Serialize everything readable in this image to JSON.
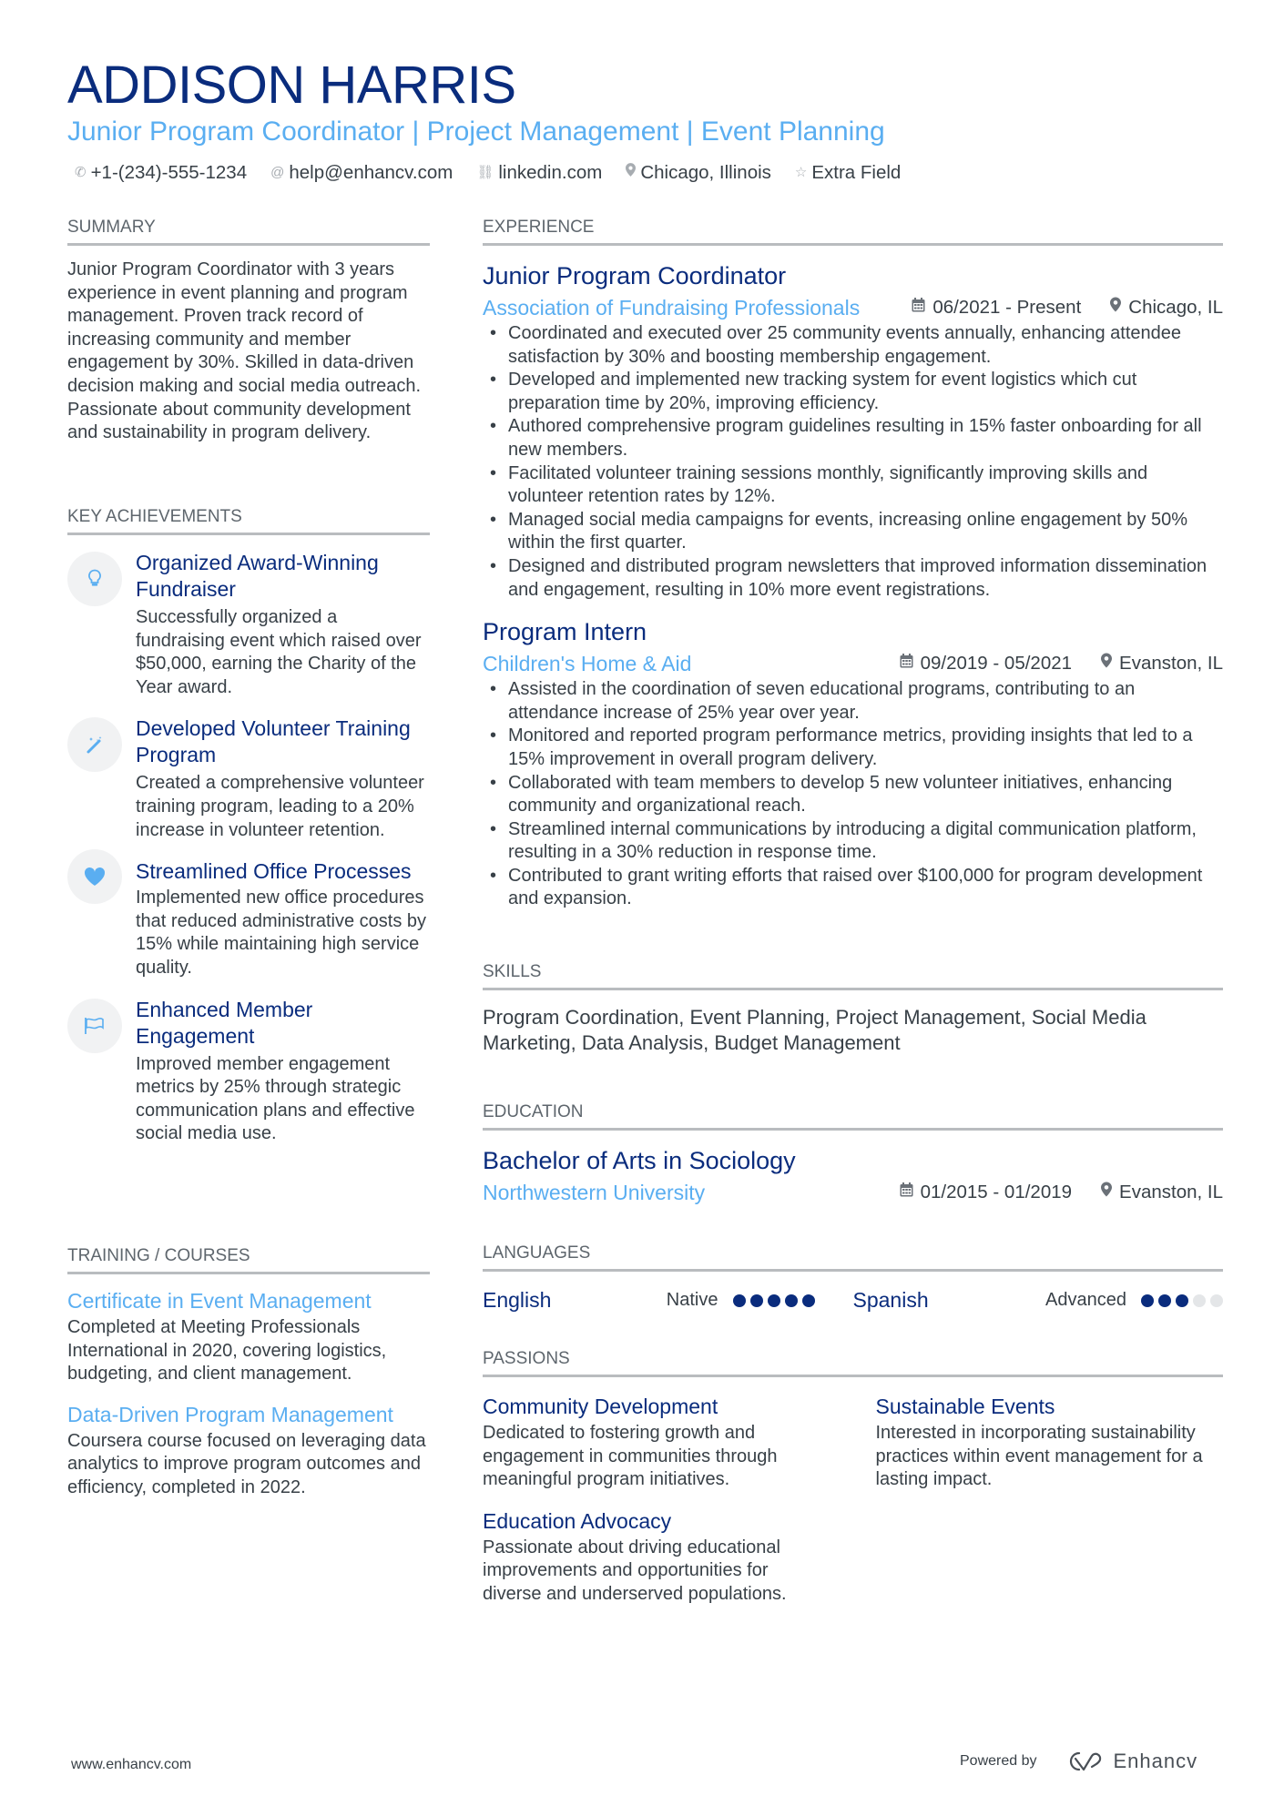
{
  "header": {
    "name": "ADDISON HARRIS",
    "subtitle": "Junior Program Coordinator | Project Management | Event Planning",
    "contacts": [
      {
        "icon": "phone-icon",
        "glyph": "✆",
        "text": "+1-(234)-555-1234"
      },
      {
        "icon": "at-icon",
        "glyph": "@",
        "text": "help@enhancv.com"
      },
      {
        "icon": "link-icon",
        "glyph": "🔗︎",
        "text": "linkedin.com"
      },
      {
        "icon": "location-icon",
        "glyph": "⚲",
        "text": "Chicago, Illinois"
      },
      {
        "icon": "star-icon",
        "glyph": "☆",
        "text": "Extra Field"
      }
    ]
  },
  "summary": {
    "title": "SUMMARY",
    "text": "Junior Program Coordinator with 3 years experience in event planning and program management. Proven track record of increasing community and member engagement by 30%. Skilled in data-driven decision making and social media outreach. Passionate about community development and sustainability in program delivery."
  },
  "achievements": {
    "title": "KEY ACHIEVEMENTS",
    "items": [
      {
        "icon": "lightbulb-icon",
        "glyph": "💡︎",
        "title": "Organized Award-Winning Fundraiser",
        "text": "Successfully organized a fundraising event which raised over $50,000, earning the Charity of the Year award."
      },
      {
        "icon": "magic-wand-icon",
        "glyph": "⁄",
        "title": "Developed Volunteer Training Program",
        "text": "Created a comprehensive volunteer training program, leading to a 20% increase in volunteer retention."
      },
      {
        "icon": "heart-icon",
        "glyph": "♥",
        "title": "Streamlined Office Processes",
        "text": "Implemented new office procedures that reduced administrative costs by 15% while maintaining high service quality."
      },
      {
        "icon": "flag-icon",
        "glyph": "⚐",
        "title": "Enhanced Member Engagement",
        "text": "Improved member engagement metrics by 25% through strategic communication plans and effective social media use."
      }
    ]
  },
  "training": {
    "title": "TRAINING / COURSES",
    "items": [
      {
        "title": "Certificate in Event Management",
        "text": "Completed at Meeting Professionals International in 2020, covering logistics, budgeting, and client management."
      },
      {
        "title": "Data-Driven Program Management",
        "text": "Coursera course focused on leveraging data analytics to improve program outcomes and efficiency, completed in 2022."
      }
    ]
  },
  "experience": {
    "title": "EXPERIENCE",
    "jobs": [
      {
        "title": "Junior Program Coordinator",
        "company": "Association of Fundraising Professionals",
        "dates": "06/2021 - Present",
        "location": "Chicago, IL",
        "bullets": [
          "Coordinated and executed over 25 community events annually, enhancing attendee satisfaction by 30% and boosting membership engagement.",
          "Developed and implemented new tracking system for event logistics which cut preparation time by 20%, improving efficiency.",
          "Authored comprehensive program guidelines resulting in 15% faster onboarding for all new members.",
          "Facilitated volunteer training sessions monthly, significantly improving skills and volunteer retention rates by 12%.",
          "Managed social media campaigns for events, increasing online engagement by 50% within the first quarter.",
          "Designed and distributed program newsletters that improved information dissemination and engagement, resulting in 10% more event registrations."
        ]
      },
      {
        "title": "Program Intern",
        "company": "Children's Home & Aid",
        "dates": "09/2019 - 05/2021",
        "location": "Evanston, IL",
        "bullets": [
          "Assisted in the coordination of seven educational programs, contributing to an attendance increase of 25% year over year.",
          "Monitored and reported program performance metrics, providing insights that led to a 15% improvement in overall program delivery.",
          "Collaborated with team members to develop 5 new volunteer initiatives, enhancing community and organizational reach.",
          "Streamlined internal communications by introducing a digital communication platform, resulting in a 30% reduction in response time.",
          "Contributed to grant writing efforts that raised over $100,000 for program development and expansion."
        ]
      }
    ]
  },
  "skills": {
    "title": "SKILLS",
    "text": "Program Coordination, Event Planning, Project Management, Social Media Marketing, Data Analysis, Budget Management"
  },
  "education": {
    "title": "EDUCATION",
    "degree": "Bachelor of Arts in Sociology",
    "school": "Northwestern University",
    "dates": "01/2015 - 01/2019",
    "location": "Evanston, IL"
  },
  "languages": {
    "title": "LANGUAGES",
    "items": [
      {
        "name": "English",
        "level": "Native",
        "rating": 5,
        "max": 5
      },
      {
        "name": "Spanish",
        "level": "Advanced",
        "rating": 3,
        "max": 5
      }
    ]
  },
  "passions": {
    "title": "PASSIONS",
    "items": [
      {
        "title": "Community Development",
        "text": "Dedicated to fostering growth and engagement in communities through meaningful program initiatives."
      },
      {
        "title": "Sustainable Events",
        "text": "Interested in incorporating sustainability practices within event management for a lasting impact."
      },
      {
        "title": "Education Advocacy",
        "text": "Passionate about driving educational improvements and opportunities for diverse and underserved populations."
      }
    ]
  },
  "footer": {
    "website": "www.enhancv.com",
    "powered_by": "Powered by",
    "brand": "Enhancv"
  },
  "colors": {
    "primary": "#0a2c7d",
    "accent": "#5aaef1",
    "text": "#384047",
    "rule": "#b9bcbf"
  }
}
